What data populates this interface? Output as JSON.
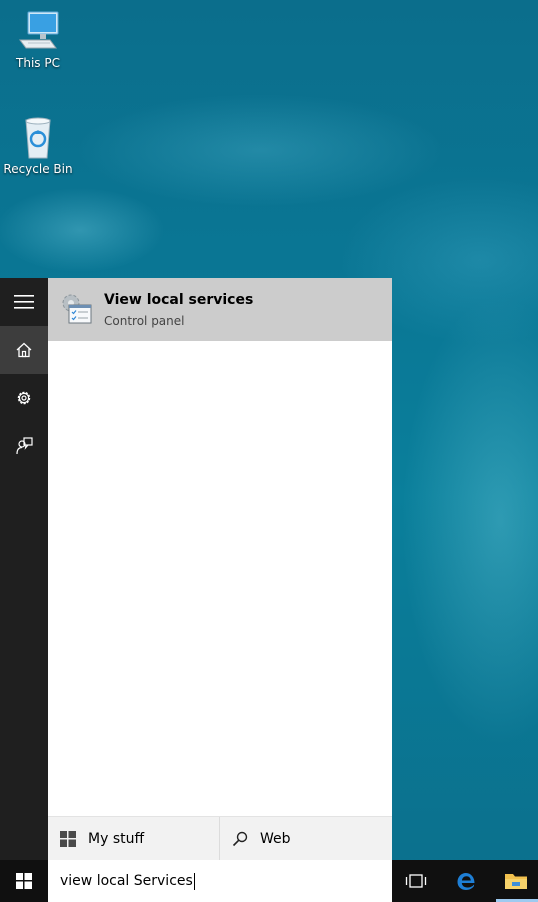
{
  "desktop": {
    "icons": [
      {
        "label": "This PC",
        "icon": "this-pc-icon"
      },
      {
        "label": "Recycle Bin",
        "icon": "recycle-bin-icon"
      }
    ]
  },
  "start": {
    "rail": [
      {
        "icon": "hamburger-menu-icon"
      },
      {
        "icon": "home-icon"
      },
      {
        "icon": "settings-gear-icon"
      },
      {
        "icon": "feedback-icon"
      }
    ],
    "results": [
      {
        "title": "View local services",
        "subtitle": "Control panel",
        "icon": "services-icon"
      }
    ],
    "scopes": {
      "my_stuff": {
        "label": "My stuff",
        "icon": "windows-logo-icon"
      },
      "web": {
        "label": "Web",
        "icon": "search-icon"
      }
    }
  },
  "search": {
    "value": "view local Services"
  },
  "taskbar": {
    "items": [
      {
        "icon": "start-windows-icon"
      },
      {
        "icon": "task-view-icon"
      },
      {
        "icon": "edge-browser-icon"
      },
      {
        "icon": "file-explorer-icon"
      }
    ]
  },
  "colors": {
    "rail_bg": "#1f1f1f",
    "taskbar_bg": "#101010",
    "result_highlight": "#cccccc",
    "edge_blue": "#1e7fd6",
    "explorer_yellow": "#f2c14e"
  }
}
